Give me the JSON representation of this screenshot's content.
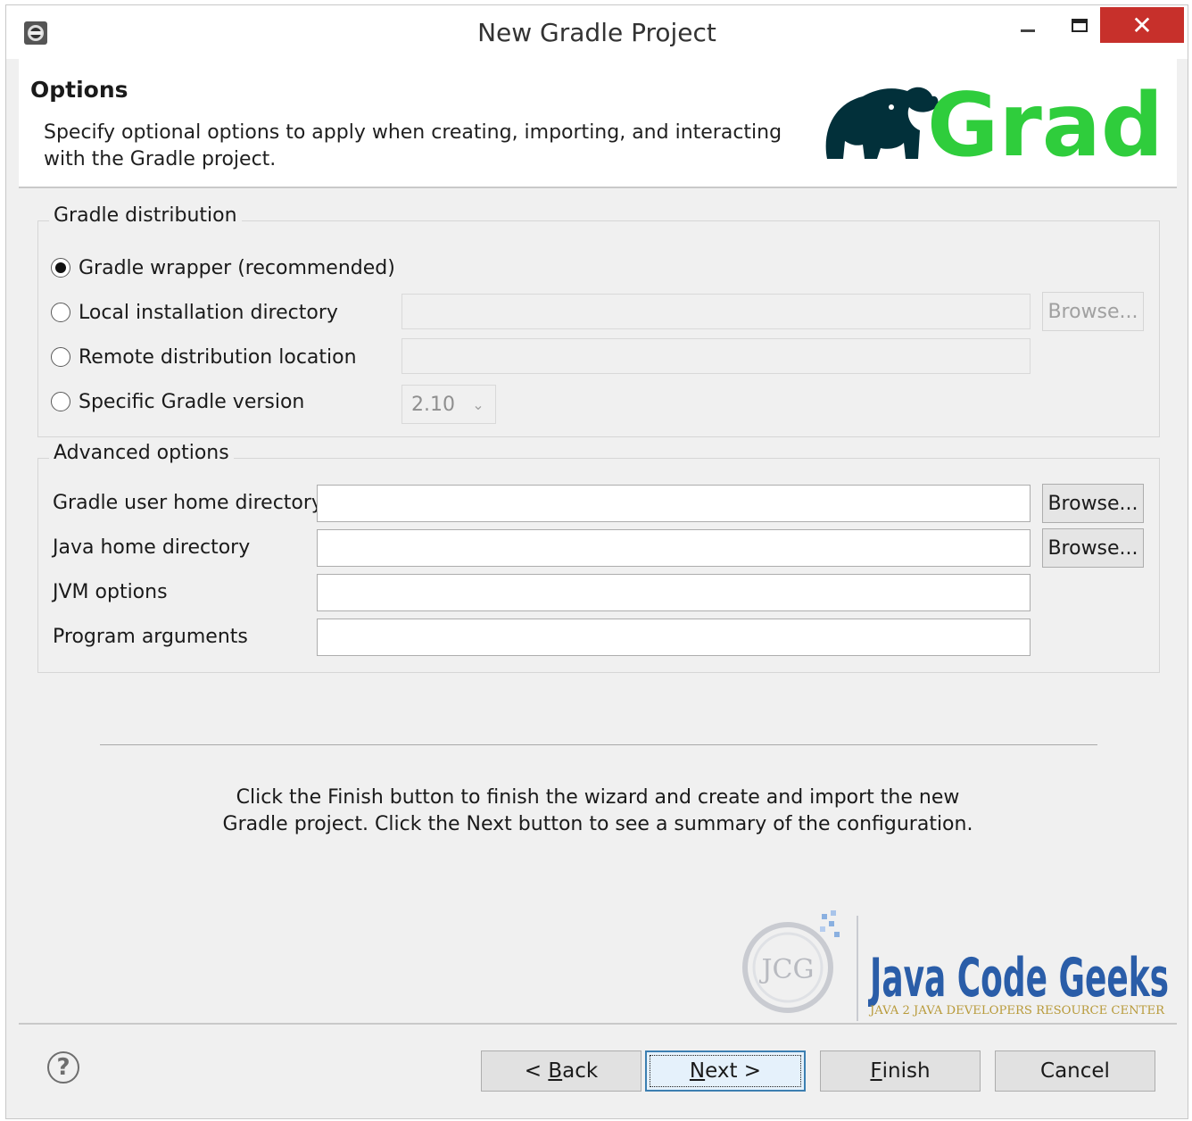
{
  "window": {
    "title": "New Gradle Project",
    "close_glyph": "✕"
  },
  "header": {
    "title": "Options",
    "description": "Specify optional options to apply when creating, importing, and interacting with the Gradle project.",
    "logo_text": "Gradle"
  },
  "distribution": {
    "legend": "Gradle distribution",
    "options": [
      {
        "label": "Gradle wrapper (recommended)",
        "selected": true
      },
      {
        "label": "Local installation directory",
        "selected": false
      },
      {
        "label": "Remote distribution location",
        "selected": false
      },
      {
        "label": "Specific Gradle version",
        "selected": false
      }
    ],
    "browse_label": "Browse...",
    "version_value": "2.10"
  },
  "advanced": {
    "legend": "Advanced options",
    "fields": [
      {
        "label": "Gradle user home directory",
        "value": ""
      },
      {
        "label": "Java home directory",
        "value": ""
      },
      {
        "label": "JVM options",
        "value": ""
      },
      {
        "label": "Program arguments",
        "value": ""
      }
    ],
    "browse_label": "Browse..."
  },
  "info": {
    "line1": "Click the Finish button to finish the wizard and create and import the new",
    "line2": "Gradle project. Click the Next button to see a summary of the configuration."
  },
  "watermark": {
    "main": "Java Code Geeks",
    "sub": "JAVA 2 JAVA DEVELOPERS RESOURCE CENTER",
    "badge": "JCG"
  },
  "footer": {
    "help": "?",
    "back": {
      "prefix": "< ",
      "mnemonic": "B",
      "rest": "ack"
    },
    "next": {
      "mnemonic": "N",
      "rest": "ext >"
    },
    "finish": {
      "mnemonic": "F",
      "rest": "inish"
    },
    "cancel": "Cancel"
  },
  "colors": {
    "gradle_green": "#2fcd3c",
    "gradle_dark": "#02303a",
    "close_red": "#c7302b",
    "jcg_blue": "#2a5da8",
    "jcg_green": "#7fb32a"
  }
}
